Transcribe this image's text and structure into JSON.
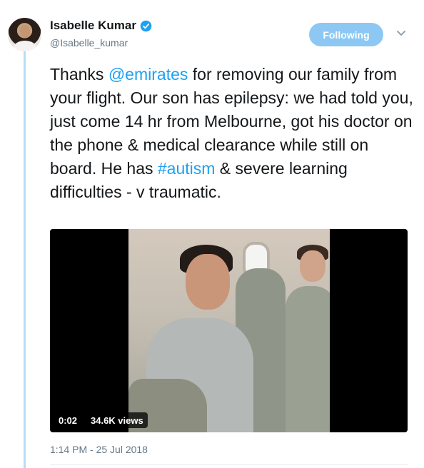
{
  "user": {
    "name": "Isabelle Kumar",
    "handle": "@Isabelle_kumar",
    "verified_color": "#1da1f2"
  },
  "follow_button": {
    "label": "Following",
    "color": "#8cc8f3"
  },
  "tweet": {
    "segments": [
      {
        "text": "Thanks ",
        "type": "text"
      },
      {
        "text": "@emirates",
        "type": "mention"
      },
      {
        "text": " for removing our family from your flight. Our son has epilepsy: we had told you, just come 14 hr from Melbourne, got his doctor on the phone & medical clearance while still on board. He has ",
        "type": "text"
      },
      {
        "text": "#autism",
        "type": "hashtag"
      },
      {
        "text": " & severe learning difficulties - v traumatic.",
        "type": "text"
      }
    ],
    "link_color": "#1da1f2"
  },
  "video": {
    "duration": "0:02",
    "views": "34.6K views"
  },
  "timestamp": "1:14 PM - 25 Jul 2018",
  "icons": {
    "verified": "verified-badge-icon",
    "caret": "chevron-down-icon",
    "avatar": "avatar-photo"
  }
}
